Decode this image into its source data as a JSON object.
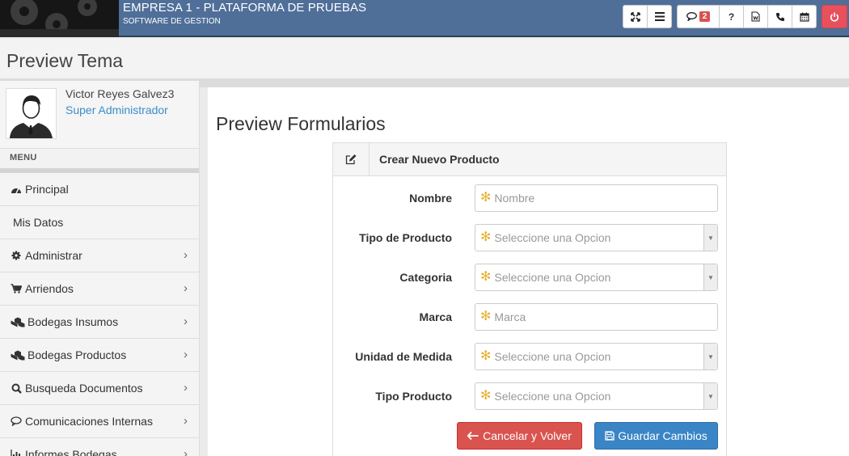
{
  "header": {
    "company": "EMPRESA 1 - PLATAFORMA DE PRUEBAS",
    "subtitle": "SOFTWARE DE GESTION",
    "messages_count": "2",
    "toolbar_icons": [
      "expand-icon",
      "menu-icon",
      "comment-icon",
      "help-icon",
      "document-icon",
      "phone-icon",
      "calendar-icon",
      "power-icon"
    ],
    "help_glyph": "?",
    "power_color": "#e8505c",
    "bar_color": "#4f6f99"
  },
  "page": {
    "title": "Preview Tema"
  },
  "sidebar": {
    "user_name": "Victor Reyes Galvez3",
    "user_role": "Super Administrador",
    "menu_label": "MENU",
    "items": [
      {
        "label": "Principal",
        "icon": "dashboard-icon",
        "has_submenu": false
      },
      {
        "label": "Mis Datos",
        "icon": "",
        "has_submenu": false
      },
      {
        "label": "Administrar",
        "icon": "gear-icon",
        "has_submenu": true
      },
      {
        "label": "Arriendos",
        "icon": "cart-icon",
        "has_submenu": true
      },
      {
        "label": "Bodegas Insumos",
        "icon": "cubes-icon",
        "has_submenu": true
      },
      {
        "label": "Bodegas Productos",
        "icon": "cubes-icon",
        "has_submenu": true
      },
      {
        "label": "Busqueda Documentos",
        "icon": "search-icon",
        "has_submenu": true
      },
      {
        "label": "Comunicaciones Internas",
        "icon": "comment-icon",
        "has_submenu": true
      },
      {
        "label": "Informes Bodegas",
        "icon": "bar-chart-icon",
        "has_submenu": true
      }
    ]
  },
  "main": {
    "title": "Preview Formularios",
    "panel_title": "Crear Nuevo Producto",
    "fields": [
      {
        "label": "Nombre",
        "placeholder": "Nombre",
        "type": "text"
      },
      {
        "label": "Tipo de Producto",
        "placeholder": "Seleccione una Opcion",
        "type": "select"
      },
      {
        "label": "Categoria",
        "placeholder": "Seleccione una Opcion",
        "type": "select"
      },
      {
        "label": "Marca",
        "placeholder": "Marca",
        "type": "text"
      },
      {
        "label": "Unidad de Medida",
        "placeholder": "Seleccione una Opcion",
        "type": "select"
      },
      {
        "label": "Tipo Producto",
        "placeholder": "Seleccione una Opcion",
        "type": "select"
      }
    ],
    "cancel_label": "Cancelar y Volver",
    "save_label": "Guardar Cambios",
    "cancel_color": "#d9534f",
    "save_color": "#3a85c6"
  }
}
